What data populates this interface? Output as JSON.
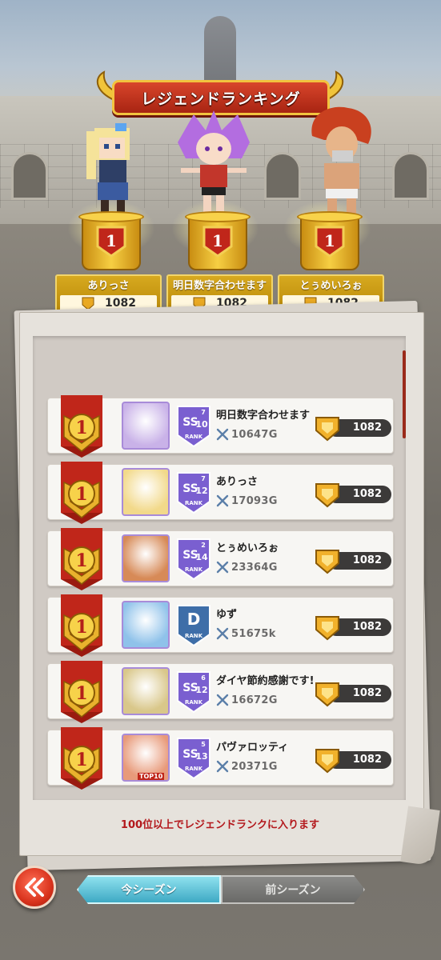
{
  "header": {
    "title": "レジェンドランキング"
  },
  "podium": [
    {
      "name": "ありっさ",
      "score": "1082",
      "rank": "1"
    },
    {
      "name": "明日数字合わせます",
      "score": "1082",
      "rank": "1"
    },
    {
      "name": "とぅめいろぉ",
      "score": "1082",
      "rank": "1"
    }
  ],
  "ranking": [
    {
      "rank": "1",
      "name": "明日数字合わせます",
      "power": "10647G",
      "tier_letter": "SS",
      "tier_num": "10",
      "tier_sup": "7",
      "score": "1082",
      "avatar_color": "#c9b2e8"
    },
    {
      "rank": "1",
      "name": "ありっさ",
      "power": "17093G",
      "tier_letter": "SS",
      "tier_num": "12",
      "tier_sup": "7",
      "score": "1082",
      "avatar_color": "#f2d98a"
    },
    {
      "rank": "1",
      "name": "とぅめいろぉ",
      "power": "23364G",
      "tier_letter": "SS",
      "tier_num": "14",
      "tier_sup": "2",
      "score": "1082",
      "avatar_color": "#d78a57"
    },
    {
      "rank": "1",
      "name": "ゆず",
      "power": "51675k",
      "tier_letter": "D",
      "tier_num": "",
      "tier_sup": "",
      "score": "1082",
      "avatar_color": "#8fc2ea"
    },
    {
      "rank": "1",
      "name": "ダイヤ節約感謝です!",
      "power": "16672G",
      "tier_letter": "SS",
      "tier_num": "12",
      "tier_sup": "6",
      "score": "1082",
      "avatar_color": "#d9c78a"
    },
    {
      "rank": "1",
      "name": "パヴァロッティ",
      "power": "20371G",
      "tier_letter": "SS",
      "tier_num": "13",
      "tier_sup": "5",
      "score": "1082",
      "avatar_color": "#e89a7a",
      "avatar_tag": "TOP10"
    }
  ],
  "rank_label": "RANK",
  "notice": "100位以上でレジェンドランクに入ります",
  "tabs": {
    "current": "今シーズン",
    "previous": "前シーズン"
  },
  "icons": {
    "back": "double-chevron-left-icon",
    "medal": "crest-medal-icon",
    "sword": "crossed-swords-icon"
  }
}
